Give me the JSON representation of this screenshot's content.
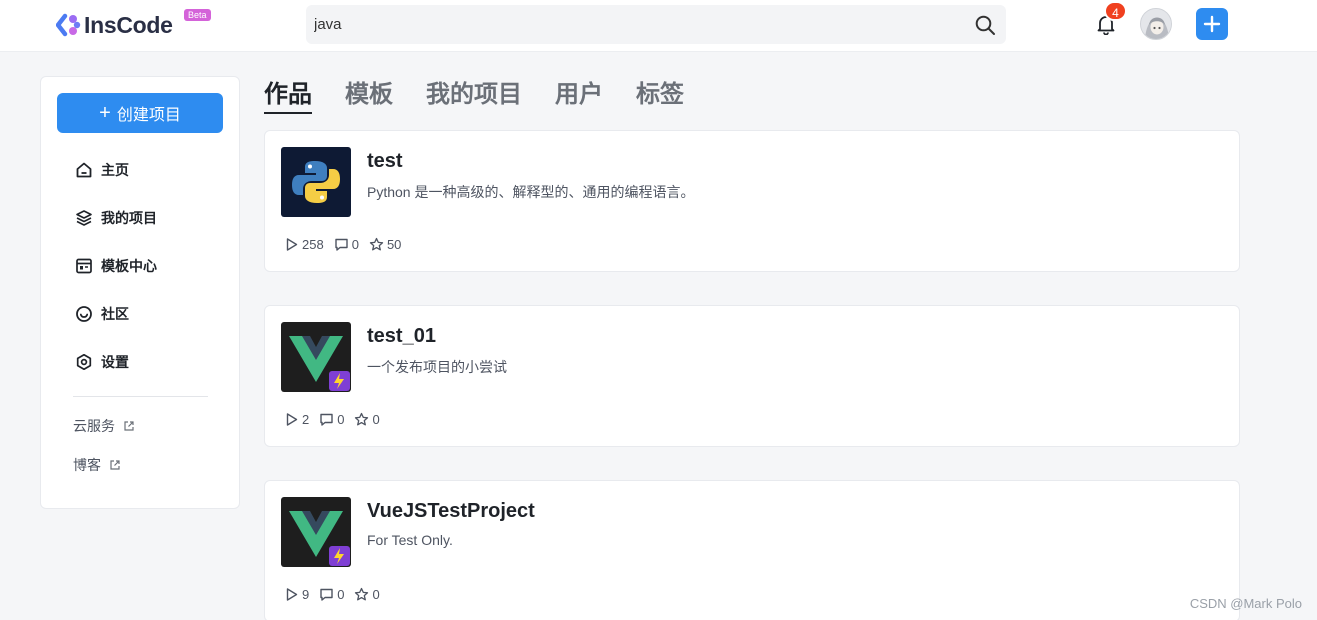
{
  "header": {
    "logo_text": "InsCode",
    "beta_label": "Beta",
    "search_value": "java",
    "notification_count": "4"
  },
  "sidebar": {
    "create_label": "创建项目",
    "items": [
      {
        "label": "主页",
        "icon": "home-icon"
      },
      {
        "label": "我的项目",
        "icon": "layers-icon"
      },
      {
        "label": "模板中心",
        "icon": "template-icon"
      },
      {
        "label": "社区",
        "icon": "smile-icon"
      },
      {
        "label": "设置",
        "icon": "settings-icon"
      }
    ],
    "links": [
      {
        "label": "云服务",
        "icon": "external-link-icon"
      },
      {
        "label": "博客",
        "icon": "external-link-icon"
      }
    ]
  },
  "tabs": [
    {
      "label": "作品",
      "active": true
    },
    {
      "label": "模板",
      "active": false
    },
    {
      "label": "我的项目",
      "active": false
    },
    {
      "label": "用户",
      "active": false
    },
    {
      "label": "标签",
      "active": false
    }
  ],
  "projects": [
    {
      "title": "test",
      "description": "Python 是一种高级的、解释型的、通用的编程语言。",
      "thumb": "python-logo",
      "runs": "258",
      "comments": "0",
      "stars": "50"
    },
    {
      "title": "test_01",
      "description": "一个发布项目的小尝试",
      "thumb": "vue-vite-logo",
      "runs": "2",
      "comments": "0",
      "stars": "0"
    },
    {
      "title": "VueJSTestProject",
      "description": "For Test Only.",
      "thumb": "vue-vite-logo",
      "runs": "9",
      "comments": "0",
      "stars": "0"
    }
  ],
  "watermark": "CSDN @Mark Polo",
  "colors": {
    "accent": "#2e8cf0",
    "badge": "#f0401f",
    "beta": "#d463d9"
  }
}
